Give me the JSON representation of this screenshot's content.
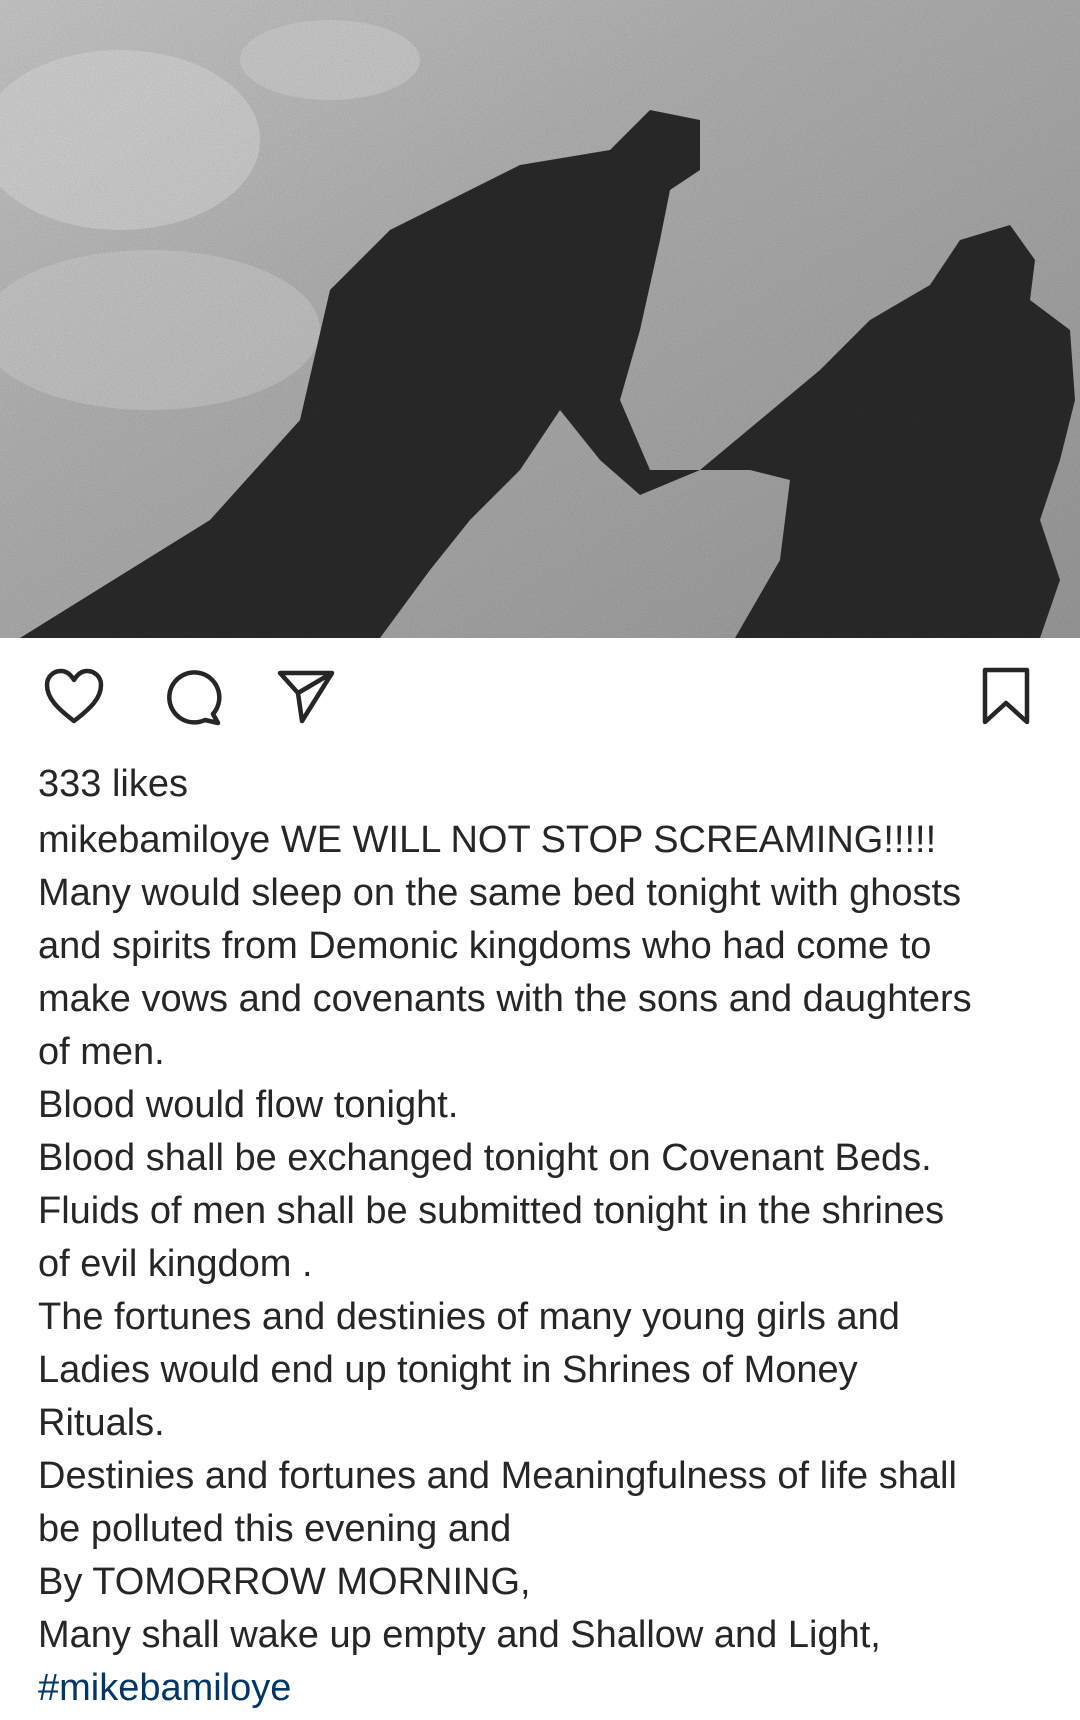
{
  "post": {
    "image_icon": "photo-shadows-holding-hands",
    "actions": {
      "like_icon": "heart-icon",
      "comment_icon": "comment-icon",
      "share_icon": "send-icon",
      "save_icon": "bookmark-icon"
    },
    "likes": "333 likes",
    "username": "mikebamiloye",
    "caption_first": "WE WILL NOT STOP SCREAMING!!!!!",
    "caption_lines": [
      "Many would sleep on the same bed tonight with ghosts",
      "and spirits from Demonic kingdoms who had come to",
      "make vows and covenants with the sons and daughters",
      "of men.",
      "Blood would flow tonight.",
      "Blood shall be exchanged tonight on Covenant Beds.",
      "Fluids of men shall be submitted tonight in the shrines",
      "of evil kingdom .",
      "The fortunes and destinies of many young girls and",
      "Ladies would end up tonight in Shrines of Money",
      "Rituals.",
      "Destinies and fortunes and Meaningfulness of life shall",
      "be polluted this evening and",
      "By TOMORROW MORNING,",
      "Many shall wake up empty and Shallow and Light,"
    ],
    "hashtag": "#mikebamiloye"
  },
  "colors": {
    "text": "#262626",
    "hashtag": "#00376b",
    "shadow": "#2b2b2b",
    "grass": "#8f8f8f"
  }
}
